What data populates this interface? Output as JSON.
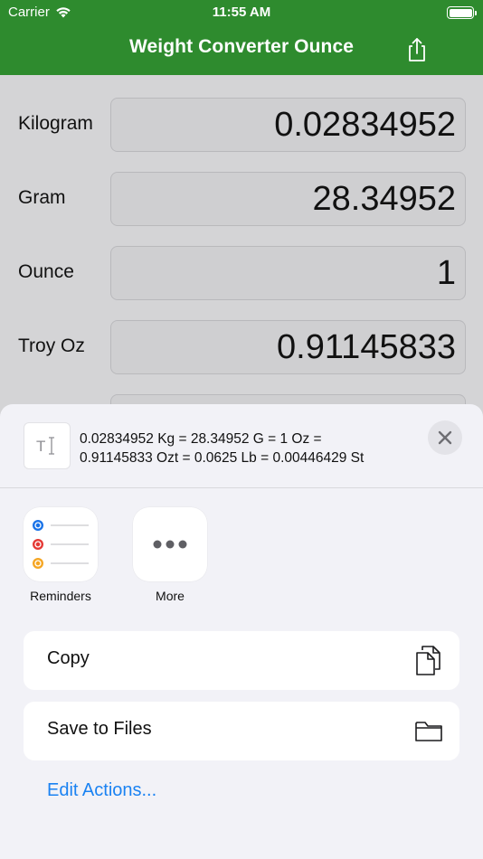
{
  "status": {
    "carrier": "Carrier",
    "time": "11:55 AM"
  },
  "nav": {
    "title": "Weight Converter Ounce"
  },
  "rows": [
    {
      "label": "Kilogram",
      "value": "0.02834952"
    },
    {
      "label": "Gram",
      "value": "28.34952"
    },
    {
      "label": "Ounce",
      "value": "1"
    },
    {
      "label": "Troy Oz",
      "value": "0.91145833"
    }
  ],
  "share": {
    "text_line1": "0.02834952 Kg = 28.34952 G = 1 Oz =",
    "text_line2": "0.91145833 Ozt = 0.0625 Lb = 0.00446429 St",
    "apps": [
      {
        "label": "Reminders",
        "icon": "reminders-icon"
      },
      {
        "label": "More",
        "icon": "more-icon"
      }
    ],
    "actions": [
      {
        "label": "Copy",
        "icon": "copy-icon"
      },
      {
        "label": "Save to Files",
        "icon": "folder-icon"
      }
    ],
    "edit_actions": "Edit Actions..."
  },
  "colors": {
    "nav_green": "#2e8b2e",
    "link_blue": "#1a82f2",
    "reminder_blue": "#1a73e8",
    "reminder_red": "#e53935",
    "reminder_orange": "#f5a623"
  }
}
